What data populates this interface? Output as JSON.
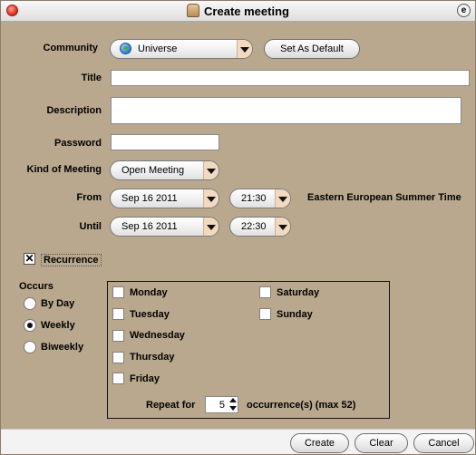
{
  "window": {
    "title": "Create meeting"
  },
  "community": {
    "label": "Community",
    "value": "Universe",
    "default_button": "Set As Default"
  },
  "title_field": {
    "label": "Title",
    "value": ""
  },
  "description": {
    "label": "Description",
    "value": ""
  },
  "password": {
    "label": "Password",
    "value": ""
  },
  "kind": {
    "label": "Kind of Meeting",
    "value": "Open Meeting"
  },
  "from": {
    "label": "From",
    "date": "Sep 16 2011",
    "time": "21:30",
    "timezone": "Eastern European Summer Time"
  },
  "until": {
    "label": "Until",
    "date": "Sep 16 2011",
    "time": "22:30"
  },
  "recurrence": {
    "label": "Recurrence",
    "checked": true,
    "check_mark": "✕"
  },
  "occurs": {
    "label": "Occurs",
    "options": [
      {
        "label": "By Day",
        "selected": false
      },
      {
        "label": "Weekly",
        "selected": true
      },
      {
        "label": "Biweekly",
        "selected": false
      }
    ]
  },
  "days": {
    "left": [
      "Monday",
      "Tuesday",
      "Wednesday",
      "Thursday",
      "Friday"
    ],
    "right": [
      "Saturday",
      "Sunday"
    ]
  },
  "repeat": {
    "label": "Repeat for",
    "value": "5",
    "suffix": "occurrence(s) (max 52)"
  },
  "buttons": {
    "create": "Create",
    "clear": "Clear",
    "cancel": "Cancel"
  }
}
